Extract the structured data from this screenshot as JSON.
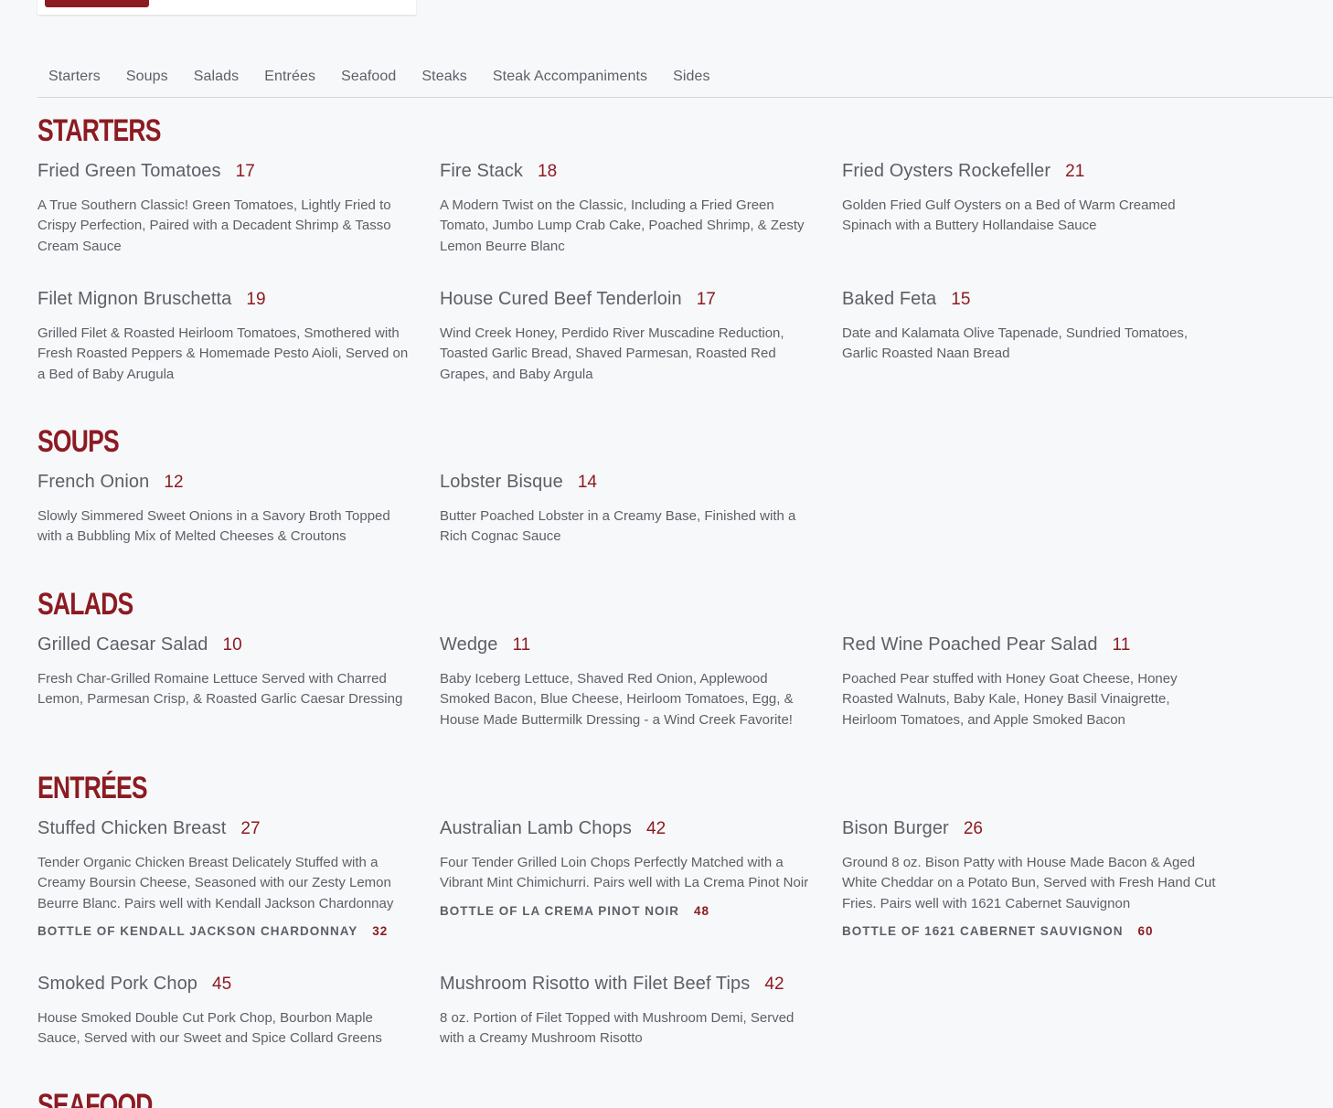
{
  "nav": {
    "tabs": [
      "Starters",
      "Soups",
      "Salads",
      "Entrées",
      "Seafood",
      "Steaks",
      "Steak Accompaniments",
      "Sides"
    ]
  },
  "sections": {
    "starters": {
      "title": "Starters",
      "items": [
        {
          "name": "Fried Green Tomatoes",
          "price": "17",
          "desc": "A True Southern Classic! Green Tomatoes, Lightly Fried to Crispy Perfection, Paired with a Decadent Shrimp & Tasso Cream Sauce"
        },
        {
          "name": "Fire Stack",
          "price": "18",
          "desc": "A Modern Twist on the Classic, Including a Fried Green Tomato, Jumbo Lump Crab Cake, Poached Shrimp, & Zesty Lemon Beurre Blanc"
        },
        {
          "name": "Fried Oysters Rockefeller",
          "price": "21",
          "desc": "Golden Fried Gulf Oysters on a Bed of Warm Creamed Spinach with a Buttery Hollandaise Sauce"
        },
        {
          "name": "Filet Mignon Bruschetta",
          "price": "19",
          "desc": "Grilled Filet & Roasted Heirloom Tomatoes, Smothered with Fresh Roasted Peppers & Homemade Pesto Aioli, Served on a Bed of Baby Arugula"
        },
        {
          "name": "House Cured Beef Tenderloin",
          "price": "17",
          "desc": "Wind Creek Honey, Perdido River Muscadine Reduction, Toasted Garlic Bread, Shaved Parmesan, Roasted Red Grapes, and Baby Argula"
        },
        {
          "name": "Baked Feta",
          "price": "15",
          "desc": "Date and Kalamata Olive Tapenade, Sundried Tomatoes, Garlic Roasted Naan Bread"
        }
      ]
    },
    "soups": {
      "title": "Soups",
      "items": [
        {
          "name": "French Onion",
          "price": "12",
          "desc": "Slowly Simmered Sweet Onions in a Savory Broth Topped with a Bubbling Mix of Melted Cheeses & Croutons"
        },
        {
          "name": "Lobster Bisque",
          "price": "14",
          "desc": "Butter Poached Lobster in a Creamy Base, Finished with a Rich Cognac Sauce"
        }
      ]
    },
    "salads": {
      "title": "Salads",
      "items": [
        {
          "name": "Grilled Caesar Salad",
          "price": "10",
          "desc": "Fresh Char-Grilled Romaine Lettuce Served with Charred Lemon, Parmesan Crisp, & Roasted Garlic Caesar Dressing"
        },
        {
          "name": "Wedge",
          "price": "11",
          "desc": "Baby Iceberg Lettuce, Shaved Red Onion, Applewood Smoked Bacon, Blue Cheese, Heirloom Tomatoes, Egg, & House Made Buttermilk Dressing - a Wind Creek Favorite!"
        },
        {
          "name": "Red Wine Poached Pear Salad",
          "price": "11",
          "desc": "Poached Pear stuffed with Honey Goat Cheese, Honey Roasted Walnuts, Baby Kale, Honey Basil Vinaigrette, Heirloom Tomatoes, and Apple Smoked Bacon"
        }
      ]
    },
    "entrees": {
      "title": "Entrées",
      "items": [
        {
          "name": "Stuffed Chicken Breast",
          "price": "27",
          "desc": "Tender Organic Chicken Breast Delicately Stuffed with a Creamy Boursin Cheese, Seasoned with our Zesty Lemon Beurre Blanc. Pairs well with Kendall Jackson Chardonnay",
          "pairing": "Bottle of Kendall Jackson Chardonnay",
          "pairing_price": "32"
        },
        {
          "name": "Australian Lamb Chops",
          "price": "42",
          "desc": "Four Tender Grilled Loin Chops Perfectly Matched with a Vibrant Mint Chimichurri. Pairs well with La Crema Pinot Noir",
          "pairing": "Bottle of La Crema Pinot Noir",
          "pairing_price": "48"
        },
        {
          "name": "Bison Burger",
          "price": "26",
          "desc": "Ground 8 oz. Bison Patty with House Made Bacon & Aged White Cheddar on a Potato Bun, Served with Fresh Hand Cut Fries. Pairs well with 1621 Cabernet Sauvignon",
          "pairing": "Bottle of 1621 Cabernet Sauvignon",
          "pairing_price": "60"
        },
        {
          "name": "Smoked Pork Chop",
          "price": "45",
          "desc": "House Smoked Double Cut Pork Chop, Bourbon Maple Sauce, Served with our Sweet and Spice Collard Greens"
        },
        {
          "name": "Mushroom Risotto with Filet Beef Tips",
          "price": "42",
          "desc": "8 oz. Portion of Filet Topped with Mushroom Demi, Served with a Creamy Mushroom Risotto"
        }
      ]
    },
    "seafood": {
      "title": "Seafood"
    }
  },
  "colors": {
    "accent": "#8c1b22",
    "text": "#5c5f66",
    "background": "#f7f8fa"
  }
}
